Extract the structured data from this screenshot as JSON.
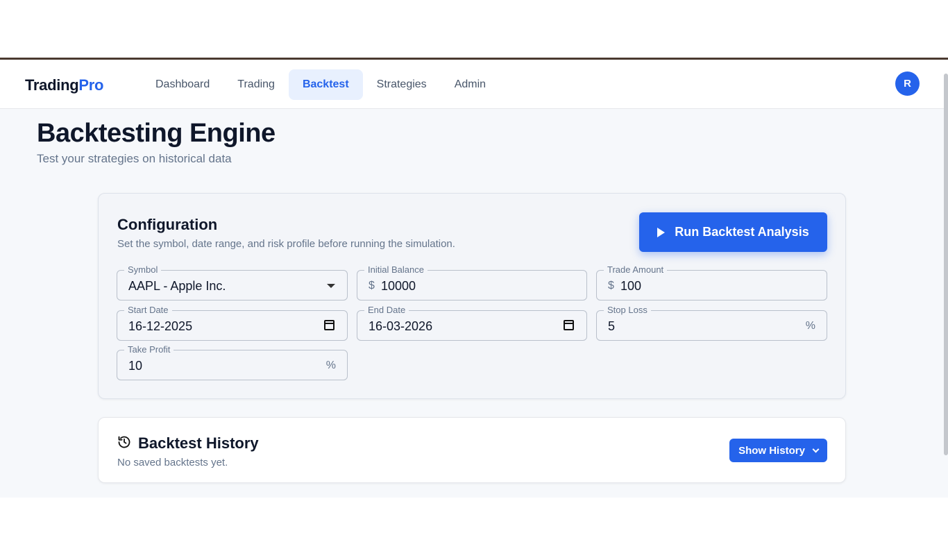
{
  "brand": {
    "name": "Trading",
    "accent": "Pro"
  },
  "nav": {
    "items": [
      {
        "label": "Dashboard",
        "active": false
      },
      {
        "label": "Trading",
        "active": false
      },
      {
        "label": "Backtest",
        "active": true
      },
      {
        "label": "Strategies",
        "active": false
      },
      {
        "label": "Admin",
        "active": false
      }
    ]
  },
  "user": {
    "avatar_initial": "R"
  },
  "page": {
    "title": "Backtesting Engine",
    "subtitle": "Test your strategies on historical data"
  },
  "config": {
    "title": "Configuration",
    "description": "Set the symbol, date range, and risk profile before running the simulation.",
    "run_button": "Run Backtest Analysis",
    "fields": {
      "symbol": {
        "label": "Symbol",
        "value": "AAPL - Apple Inc."
      },
      "initial_balance": {
        "label": "Initial Balance",
        "prefix": "$",
        "value": "10000"
      },
      "trade_amount": {
        "label": "Trade Amount",
        "prefix": "$",
        "value": "100"
      },
      "start_date": {
        "label": "Start Date",
        "value": "16-12-2025"
      },
      "end_date": {
        "label": "End Date",
        "value": "16-03-2026"
      },
      "stop_loss": {
        "label": "Stop Loss",
        "value": "5",
        "suffix": "%"
      },
      "take_profit": {
        "label": "Take Profit",
        "value": "10",
        "suffix": "%"
      }
    }
  },
  "history": {
    "title": "Backtest History",
    "empty_text": "No saved backtests yet.",
    "show_button": "Show History"
  },
  "colors": {
    "accent": "#2563eb",
    "text": "#0f172a",
    "muted": "#64748b"
  }
}
